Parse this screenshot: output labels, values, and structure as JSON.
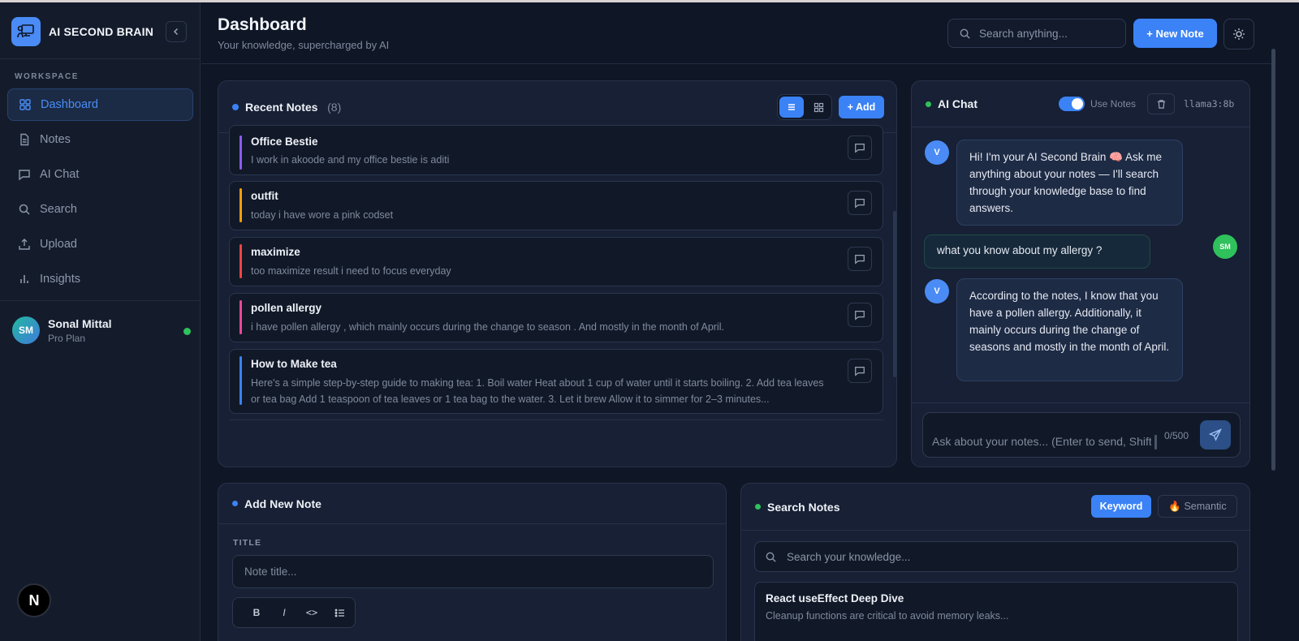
{
  "app": {
    "name": "AI SECOND BRAIN"
  },
  "sidebar": {
    "section_label": "WORKSPACE",
    "items": [
      {
        "label": "Dashboard",
        "icon": "grid-icon",
        "active": true
      },
      {
        "label": "Notes",
        "icon": "file-icon"
      },
      {
        "label": "AI Chat",
        "icon": "message-icon"
      },
      {
        "label": "Search",
        "icon": "search-icon"
      },
      {
        "label": "Upload",
        "icon": "upload-icon"
      },
      {
        "label": "Insights",
        "icon": "bar-chart-icon"
      }
    ],
    "user": {
      "initials": "SM",
      "name": "Sonal Mittal",
      "plan": "Pro Plan",
      "status_color": "#2fc15b"
    },
    "badge": "N"
  },
  "header": {
    "title": "Dashboard",
    "subtitle": "Your knowledge, supercharged by AI",
    "search_placeholder": "Search anything...",
    "new_note_label": "+ New Note"
  },
  "recent_notes": {
    "title": "Recent Notes",
    "count": "(8)",
    "add_label": "+ Add",
    "notes": [
      {
        "title": "Office Bestie",
        "body": "I work in akoode and my office bestie is aditi",
        "color": "#8b5cf6"
      },
      {
        "title": "outfit",
        "body": "today i have wore a pink codset",
        "color": "#f59e0b"
      },
      {
        "title": "maximize",
        "body": "too maximize result i need to focus everyday",
        "color": "#ef4444"
      },
      {
        "title": "pollen allergy",
        "body": "i have pollen allergy , which mainly occurs during the change to season . And mostly in the month of April.",
        "color": "#ec4899"
      },
      {
        "title": "How to Make tea",
        "body": "Here's a simple step-by-step guide to making tea: 1. Boil water Heat about 1 cup of water until it starts boiling. 2. Add tea leaves or tea bag Add 1 teaspoon of tea leaves or 1 tea bag to the water. 3. Let it brew Allow it to simmer for 2–3 minutes...",
        "color": "#3b82f6"
      }
    ]
  },
  "ai_chat": {
    "title": "AI Chat",
    "use_notes_label": "Use Notes",
    "model": "llama3:8b",
    "bot_initial": "V",
    "user_initials": "SM",
    "messages": [
      {
        "role": "bot",
        "text": "Hi! I'm your AI Second Brain 🧠 Ask me anything about your notes — I'll search through your knowledge base to find answers."
      },
      {
        "role": "user",
        "text": "what you know about my allergy ?"
      },
      {
        "role": "bot",
        "text": "According to the notes, I know that you have a pollen allergy. Additionally, it mainly occurs during the change of seasons and mostly in the month of April."
      }
    ],
    "input_placeholder": "Ask about your notes... (Enter to send, Shift+Enter for new line)",
    "char_count": "0/500"
  },
  "add_note": {
    "title": "Add New Note",
    "field_label": "TITLE",
    "title_placeholder": "Note title...",
    "toolbar": {
      "bold": "B",
      "italic": "I",
      "code": "<>"
    }
  },
  "search_notes": {
    "title": "Search Notes",
    "keyword_label": "Keyword",
    "semantic_label": "🔥 Semantic",
    "placeholder": "Search your knowledge...",
    "results": [
      {
        "title": "React useEffect Deep Dive",
        "body": "Cleanup functions are critical to avoid memory leaks..."
      }
    ]
  },
  "colors": {
    "accent": "#3b82f6",
    "success": "#2fc15b",
    "background": "#0f1626"
  }
}
